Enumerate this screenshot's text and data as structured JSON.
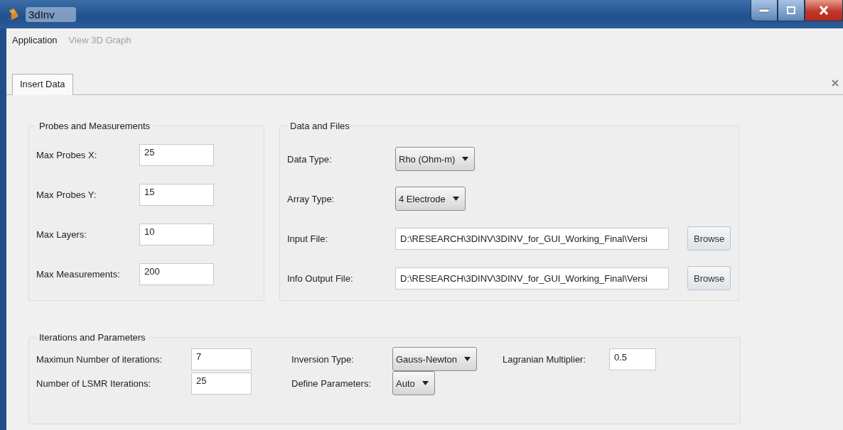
{
  "window": {
    "title": "3dInv"
  },
  "menu": [
    {
      "label": "Application",
      "disabled": false
    },
    {
      "label": "View 3D Graph",
      "disabled": true
    }
  ],
  "tabs": [
    {
      "label": "Insert Data",
      "selected": true
    }
  ],
  "probes": {
    "title": "Probes and Measurements",
    "fields": [
      {
        "label": "Max Probes X:",
        "value": "25"
      },
      {
        "label": "Max Probes Y:",
        "value": "15"
      },
      {
        "label": "Max Layers:",
        "value": "10"
      },
      {
        "label": "Max Measurements:",
        "value": "200"
      }
    ]
  },
  "data_files": {
    "title": "Data and Files",
    "rows": [
      {
        "kind": "combo",
        "label": "Data Type:",
        "value": "Rho (Ohm-m)"
      },
      {
        "kind": "combo",
        "label": "Array Type:",
        "value": "4 Electrode"
      },
      {
        "kind": "file",
        "label": "Input File:",
        "value": "D:\\RESEARCH\\3DINV\\3DINV_for_GUI_Working_Final\\Versi",
        "button": "Browse"
      },
      {
        "kind": "file",
        "label": "Info Output File:",
        "value": "D:\\RESEARCH\\3DINV\\3DINV_for_GUI_Working_Final\\Versi",
        "button": "Browse"
      }
    ]
  },
  "iterations": {
    "title": "Iterations and Parameters",
    "rows": [
      [
        {
          "kind": "text",
          "label": "Maximun Number of iterations:",
          "value": "7"
        },
        {
          "kind": "combo",
          "label": "Inversion Type:",
          "value": "Gauss-Newton"
        },
        {
          "kind": "text",
          "label": "Lagranian Multiplier:",
          "value": "0.5"
        }
      ],
      [
        {
          "kind": "text",
          "label": "Number of LSMR Iterations:",
          "value": "25"
        },
        {
          "kind": "combo",
          "label": "Define Parameters:",
          "value": "Auto"
        }
      ]
    ]
  }
}
